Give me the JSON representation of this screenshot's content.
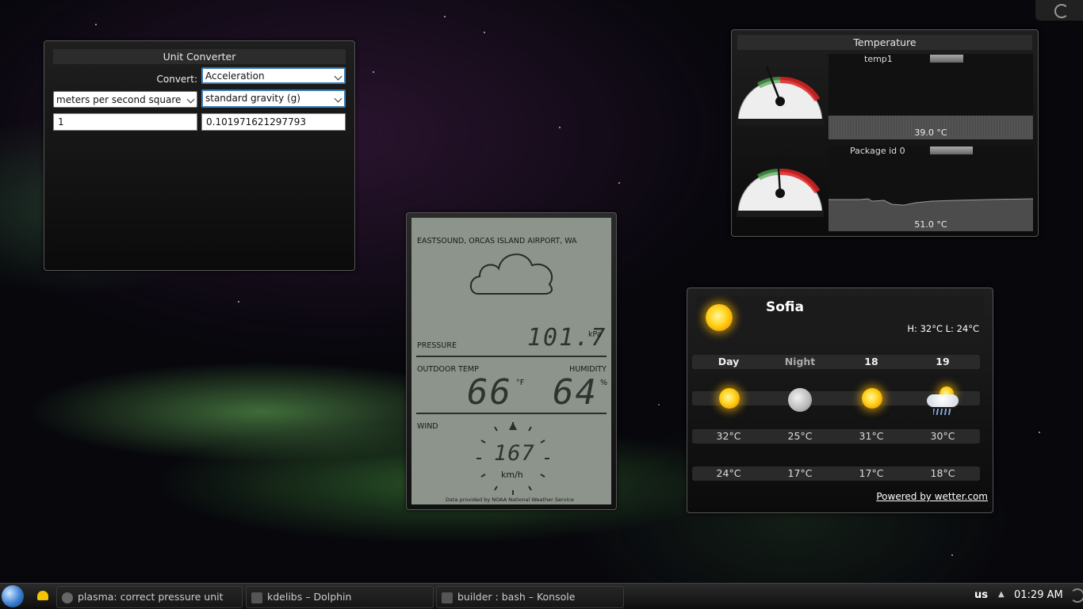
{
  "unit_converter": {
    "title": "Unit Converter",
    "convert_label": "Convert:",
    "category": "Acceleration",
    "from_unit": "meters per second square",
    "to_unit": "standard gravity (g)",
    "input_value": "1",
    "output_value": "0.101971621297793"
  },
  "temperature": {
    "title": "Temperature",
    "sensors": [
      {
        "name": "temp1",
        "value": "39.0 °C"
      },
      {
        "name": "Package id 0",
        "value": "51.0 °C"
      }
    ]
  },
  "weather_station": {
    "location": "EASTSOUND, ORCAS ISLAND AIRPORT, WA",
    "pressure_label": "PRESSURE",
    "pressure_value": "101.7",
    "pressure_unit": "kPa",
    "outdoor_temp_label": "OUTDOOR TEMP",
    "outdoor_temp_value": "66",
    "outdoor_temp_unit": "°F",
    "humidity_label": "HUMIDITY",
    "humidity_value": "64",
    "humidity_unit": "%",
    "wind_label": "WIND",
    "wind_value": "167",
    "wind_unit": "km/h",
    "credit": "Data provided by NOAA National Weather Service"
  },
  "weather_forecast": {
    "city": "Sofia",
    "high_low": "H: 32°C L: 24°C",
    "columns": [
      {
        "label": "Day",
        "icon": "sun-icon",
        "high": "32°C",
        "low": "24°C"
      },
      {
        "label": "Night",
        "icon": "moon-icon",
        "high": "25°C",
        "low": "17°C"
      },
      {
        "label": "18",
        "icon": "sun-icon",
        "high": "31°C",
        "low": "17°C"
      },
      {
        "label": "19",
        "icon": "sun-cloud-rain-icon",
        "high": "30°C",
        "low": "18°C"
      }
    ],
    "credit": "Powered by wetter.com"
  },
  "taskbar": {
    "tasks": [
      {
        "label": "plasma: correct pressure unit"
      },
      {
        "label": "kdelibs – Dolphin"
      },
      {
        "label": "builder : bash – Konsole"
      }
    ],
    "keyboard_layout": "us",
    "clock": "01:29 AM"
  }
}
